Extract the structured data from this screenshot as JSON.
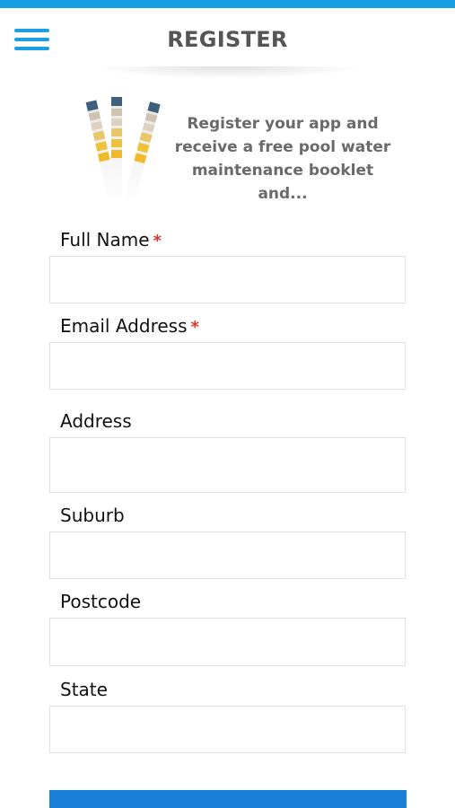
{
  "header": {
    "title": "REGISTER",
    "menu_icon": "hamburger-menu-icon"
  },
  "promo": {
    "image_icon": "test-strips-icon",
    "text": "Register your app and receive a free pool water maintenance booklet and..."
  },
  "form": {
    "fields": [
      {
        "label": "Full Name",
        "required_mark": "*",
        "value": ""
      },
      {
        "label": "Email Address",
        "required_mark": "*",
        "value": ""
      },
      {
        "label": "Address",
        "value": ""
      },
      {
        "label": "Suburb",
        "value": ""
      },
      {
        "label": "Postcode",
        "value": ""
      },
      {
        "label": "State",
        "value": ""
      }
    ]
  },
  "colors": {
    "accent": "#1a9fe5",
    "button": "#1a7fd8",
    "required": "#d9342b",
    "title": "#555555",
    "promo_text": "#6a6a6a"
  }
}
